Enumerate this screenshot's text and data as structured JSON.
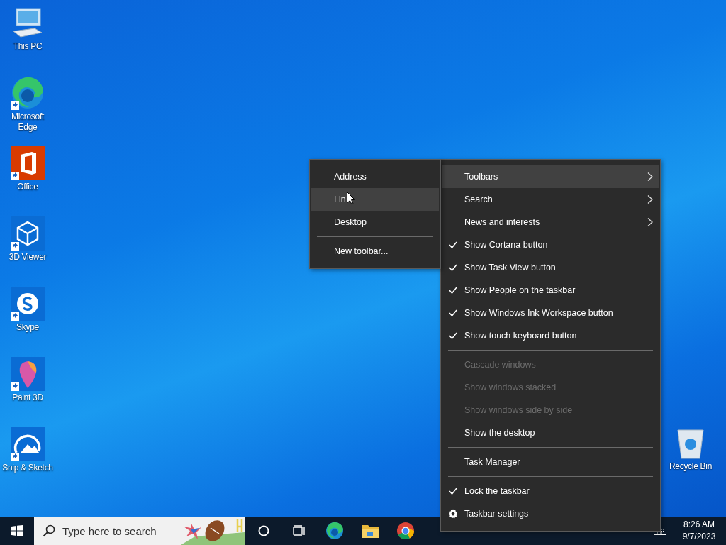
{
  "desktop_icons": [
    {
      "label": "This PC"
    },
    {
      "label": "Microsoft Edge"
    },
    {
      "label": "Office"
    },
    {
      "label": "3D Viewer"
    },
    {
      "label": "Skype"
    },
    {
      "label": "Paint 3D"
    },
    {
      "label": "Snip & Sketch"
    }
  ],
  "recycle_bin": {
    "label": "Recycle Bin"
  },
  "toolbars_submenu": {
    "items": [
      {
        "kind": "item",
        "label": "Address",
        "selected": false
      },
      {
        "kind": "item",
        "label": "Lin",
        "selected": true
      },
      {
        "kind": "item",
        "label": "Desktop",
        "selected": false
      },
      {
        "kind": "separator"
      },
      {
        "kind": "item",
        "label": "New toolbar...",
        "selected": false
      }
    ]
  },
  "context_menu": {
    "items": [
      {
        "kind": "item",
        "label": "Toolbars",
        "submenu": true,
        "checked": false,
        "disabled": false,
        "selected": true
      },
      {
        "kind": "item",
        "label": "Search",
        "submenu": true,
        "checked": false,
        "disabled": false,
        "selected": false
      },
      {
        "kind": "item",
        "label": "News and interests",
        "submenu": true,
        "checked": false,
        "disabled": false,
        "selected": false
      },
      {
        "kind": "item",
        "label": "Show Cortana button",
        "submenu": false,
        "checked": true,
        "disabled": false,
        "selected": false
      },
      {
        "kind": "item",
        "label": "Show Task View button",
        "submenu": false,
        "checked": true,
        "disabled": false,
        "selected": false
      },
      {
        "kind": "item",
        "label": "Show People on the taskbar",
        "submenu": false,
        "checked": true,
        "disabled": false,
        "selected": false
      },
      {
        "kind": "item",
        "label": "Show Windows Ink Workspace button",
        "submenu": false,
        "checked": true,
        "disabled": false,
        "selected": false
      },
      {
        "kind": "item",
        "label": "Show touch keyboard button",
        "submenu": false,
        "checked": true,
        "disabled": false,
        "selected": false
      },
      {
        "kind": "separator"
      },
      {
        "kind": "item",
        "label": "Cascade windows",
        "submenu": false,
        "checked": false,
        "disabled": true,
        "selected": false
      },
      {
        "kind": "item",
        "label": "Show windows stacked",
        "submenu": false,
        "checked": false,
        "disabled": true,
        "selected": false
      },
      {
        "kind": "item",
        "label": "Show windows side by side",
        "submenu": false,
        "checked": false,
        "disabled": true,
        "selected": false
      },
      {
        "kind": "item",
        "label": "Show the desktop",
        "submenu": false,
        "checked": false,
        "disabled": false,
        "selected": false
      },
      {
        "kind": "separator"
      },
      {
        "kind": "item",
        "label": "Task Manager",
        "submenu": false,
        "checked": false,
        "disabled": false,
        "selected": false
      },
      {
        "kind": "separator"
      },
      {
        "kind": "item",
        "label": "Lock the taskbar",
        "submenu": false,
        "checked": true,
        "disabled": false,
        "selected": false
      },
      {
        "kind": "settings",
        "label": "Taskbar settings",
        "submenu": false,
        "checked": false,
        "disabled": false,
        "selected": false
      }
    ]
  },
  "taskbar": {
    "search": {
      "placeholder": "Type here to search"
    },
    "clock": {
      "time": "8:26 AM",
      "date": "9/7/2023"
    }
  }
}
